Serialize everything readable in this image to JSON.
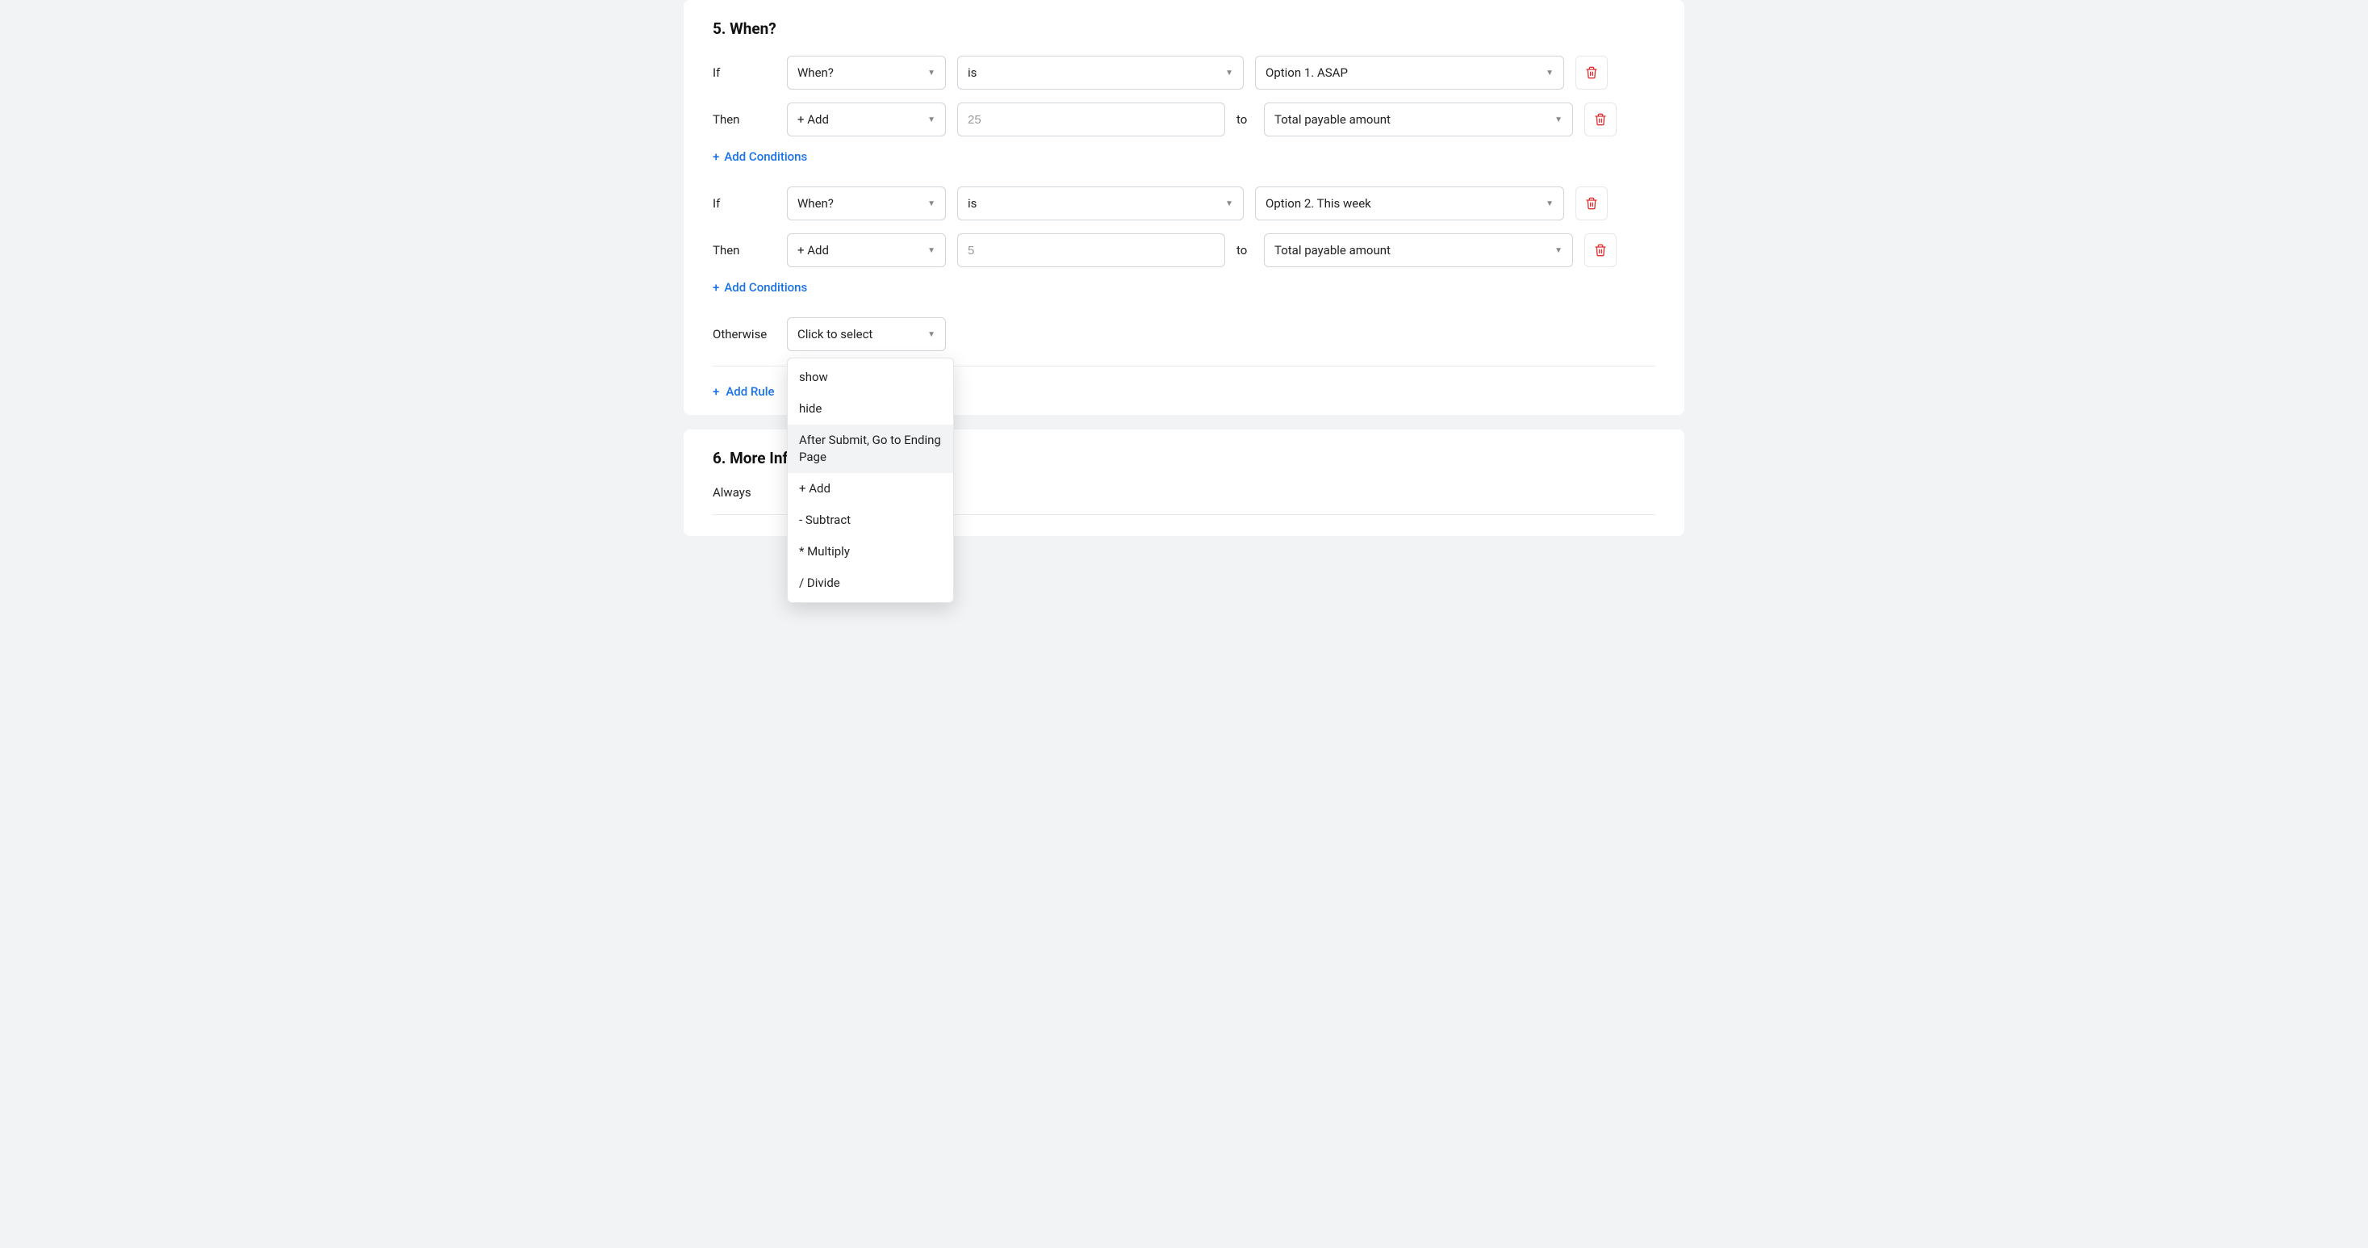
{
  "section5": {
    "title": "5. When?",
    "block1": {
      "if_label": "If",
      "then_label": "Then",
      "field": "When?",
      "comparator": "is",
      "value": "Option 1. ASAP",
      "action": "+ Add",
      "amount_placeholder": "25",
      "to_label": "to",
      "target": "Total payable amount"
    },
    "add_conditions": "Add Conditions",
    "block2": {
      "if_label": "If",
      "then_label": "Then",
      "field": "When?",
      "comparator": "is",
      "value": "Option 2. This week",
      "action": "+ Add",
      "amount_placeholder": "5",
      "to_label": "to",
      "target": "Total payable amount"
    },
    "otherwise_label": "Otherwise",
    "otherwise_select": "Click to select",
    "dropdown_options": [
      "show",
      "hide",
      "After Submit, Go to Ending Page",
      "+ Add",
      "- Subtract",
      "* Multiply",
      "/ Divide"
    ],
    "dropdown_highlight_index": 2,
    "add_rule": "Add Rule"
  },
  "section6": {
    "title": "6. More Inf",
    "always_label": "Always"
  }
}
